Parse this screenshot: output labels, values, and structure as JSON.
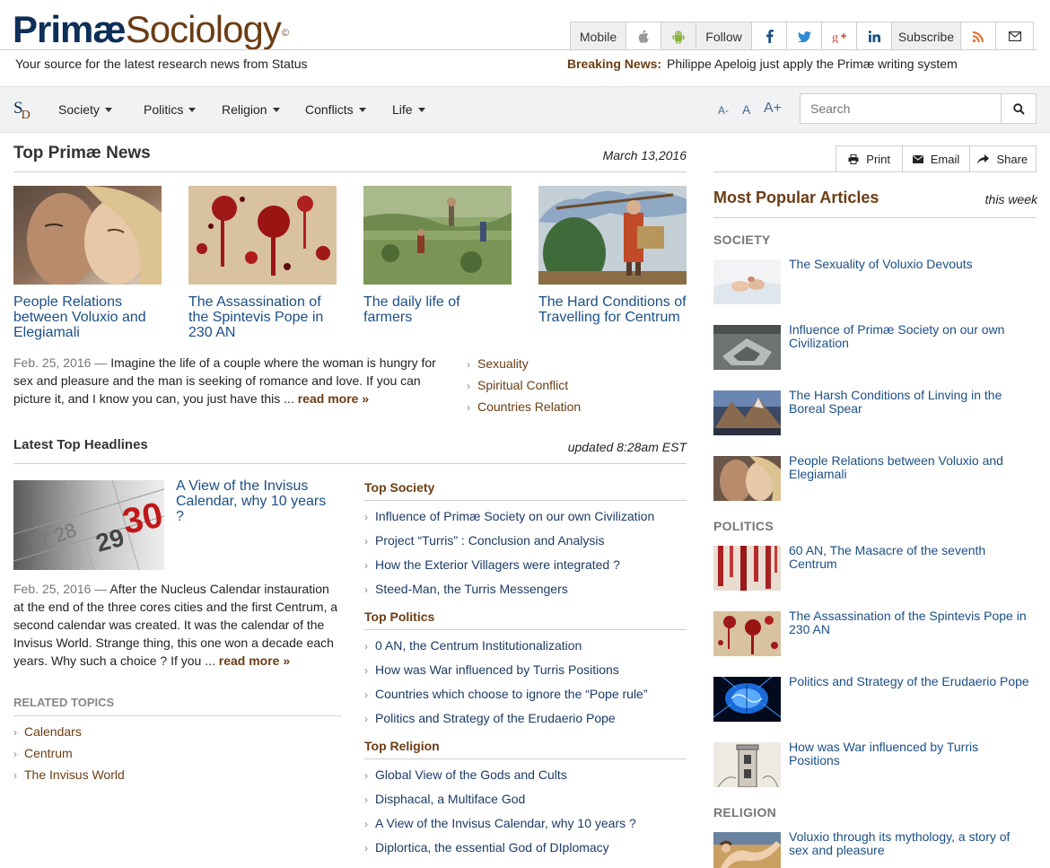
{
  "brand": {
    "name_bold": "Primæ",
    "name_light": "Sociology",
    "mark": "©",
    "tagline": "Your source for the latest research news from Status"
  },
  "breaking": {
    "label": "Breaking News:",
    "text": "Philippe Apeloig just apply the Primæ writing system"
  },
  "topbar": {
    "mobile": "Mobile",
    "follow": "Follow",
    "subscribe": "Subscribe"
  },
  "logo_small": {
    "s": "S",
    "d": "D"
  },
  "nav": {
    "items": [
      {
        "label": "Society"
      },
      {
        "label": "Politics"
      },
      {
        "label": "Religion"
      },
      {
        "label": "Conflicts"
      },
      {
        "label": "Life"
      }
    ]
  },
  "font_sizes": {
    "small": "A-",
    "normal": "A",
    "large": "A+"
  },
  "search": {
    "placeholder": "Search"
  },
  "top_news": {
    "heading": "Top Primæ News",
    "date": "March 13,2016",
    "cards": [
      {
        "title": "People Relations between Voluxio and Elegiamali"
      },
      {
        "title": "The Assassination of the Spintevis Pope in 230 AN"
      },
      {
        "title": "The daily life of farmers"
      },
      {
        "title": "The Hard Conditions of Travelling for Centrum"
      }
    ],
    "excerpt": {
      "date": "Feb. 25, 2016",
      "dash": "—",
      "text": "Imagine the life of a couple where the woman is hungry for sex and pleasure and the man is seeking of romance and love. If you can picture it, and I know you can, you just have this ...",
      "more": "read more »"
    },
    "tags": [
      "Sexuality",
      "Spiritual Conflict",
      "Countries Relation"
    ]
  },
  "latest": {
    "heading": "Latest Top Headlines",
    "updated": "updated 8:28am EST",
    "feature": {
      "title": "A View of the Invisus Calendar, why 10 years ?",
      "date": "Feb. 25, 2016",
      "dash": "—",
      "text": "After the Nucleus Calendar instauration at the end of the three cores cities and the first Centrum, a second calendar was created. It was the calendar of the Invisus World. Strange thing, this one won a decade each years. Why such a choice ? If you ...",
      "more": "read more »",
      "calendar_numbers": [
        "29",
        "30"
      ]
    },
    "related_heading": "RELATED TOPICS",
    "related": [
      "Calendars",
      "Centrum",
      "The Invisus World"
    ],
    "categories": [
      {
        "name": "Top Society",
        "links": [
          "Influence of Primæ Society on our own Civilization",
          "Project “Turris” : Conclusion and Analysis",
          "How the Exterior Villagers were integrated ?",
          "Steed-Man, the Turris Messengers"
        ]
      },
      {
        "name": "Top Politics",
        "links": [
          "0 AN, the Centrum Institutionalization",
          "How was War influenced by Turris Positions",
          "Countries which choose to ignore the “Pope rule”",
          "Politics and Strategy of the Erudaerio Pope"
        ]
      },
      {
        "name": "Top Religion",
        "links": [
          "Global View of the Gods and Cults",
          "Disphacal, a Multiface God",
          "A View of the Invisus Calendar, why 10 years ?",
          "Diplortica, the essential God of DIplomacy"
        ]
      }
    ]
  },
  "share": {
    "print": "Print",
    "email": "Email",
    "share": "Share"
  },
  "popular": {
    "heading": "Most Popular Articles",
    "period": "this week",
    "sections": [
      {
        "name": "SOCIETY",
        "items": [
          "The Sexuality of Voluxio Devouts",
          "Influence of Primæ Society on our own Civilization",
          "The Harsh Conditions of Linving in the Boreal Spear",
          "People Relations between Voluxio and Elegiamali"
        ]
      },
      {
        "name": "POLITICS",
        "items": [
          "60 AN, The Masacre of the seventh Centrum",
          "The Assassination of the Spintevis Pope in 230 AN",
          "Politics and Strategy of the Erudaerio Pope",
          "How was War influenced by Turris Positions"
        ]
      },
      {
        "name": "RELIGION",
        "items": [
          "Voluxio through its mythology, a story of sex and pleasure"
        ]
      }
    ]
  },
  "colors": {
    "brand_blue": "#0d2f58",
    "brand_brown": "#6b3d14",
    "link_blue": "#1b4f86"
  }
}
